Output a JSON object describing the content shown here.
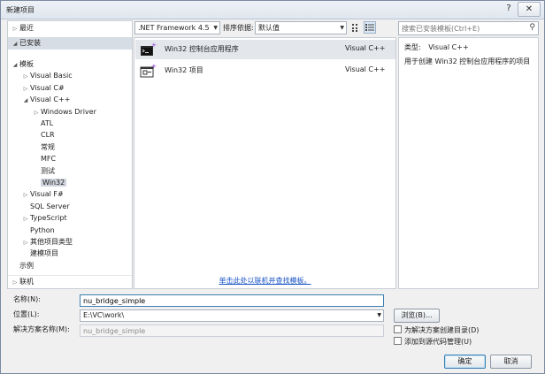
{
  "window": {
    "title": "新建项目",
    "help": "?",
    "close": "✕"
  },
  "left_panel": {
    "recent": "最近",
    "installed": "已安装",
    "tree": [
      {
        "label": "模板",
        "arrow": "◢",
        "indent": 0
      },
      {
        "label": "Visual Basic",
        "arrow": "▷",
        "indent": 1
      },
      {
        "label": "Visual C#",
        "arrow": "▷",
        "indent": 1
      },
      {
        "label": "Visual C++",
        "arrow": "◢",
        "indent": 1
      },
      {
        "label": "Windows Driver",
        "arrow": "▷",
        "indent": 2
      },
      {
        "label": "ATL",
        "arrow": "",
        "indent": 2
      },
      {
        "label": "CLR",
        "arrow": "",
        "indent": 2
      },
      {
        "label": "常规",
        "arrow": "",
        "indent": 2
      },
      {
        "label": "MFC",
        "arrow": "",
        "indent": 2
      },
      {
        "label": "测试",
        "arrow": "",
        "indent": 2
      },
      {
        "label": "Win32",
        "arrow": "",
        "indent": 2,
        "selected": true
      },
      {
        "label": "Visual F#",
        "arrow": "▷",
        "indent": 1
      },
      {
        "label": "SQL Server",
        "arrow": "",
        "indent": 1
      },
      {
        "label": "TypeScript",
        "arrow": "▷",
        "indent": 1
      },
      {
        "label": "Python",
        "arrow": "",
        "indent": 1
      },
      {
        "label": "其他项目类型",
        "arrow": "▷",
        "indent": 1
      },
      {
        "label": "建模项目",
        "arrow": "",
        "indent": 1
      },
      {
        "label": "示例",
        "arrow": "",
        "indent": 0
      }
    ],
    "online": "联机"
  },
  "toolbar": {
    "framework": ".NET Framework 4.5",
    "sort_label": "排序依据:",
    "sort_value": "默认值",
    "view_small_icons": "small-icons-view",
    "view_list": "list-view"
  },
  "search": {
    "placeholder": "搜索已安装模板(Ctrl+E)",
    "icon": "search-icon"
  },
  "templates": [
    {
      "name": "Win32 控制台应用程序",
      "lang": "Visual C++",
      "icon": "console-app-icon",
      "selected": true
    },
    {
      "name": "Win32 项目",
      "lang": "Visual C++",
      "icon": "win32-project-icon",
      "selected": false
    }
  ],
  "online_link": "单击此处以联机并查找模板。",
  "details": {
    "type_label": "类型:",
    "type_value": "Visual C++",
    "description": "用于创建 Win32 控制台应用程序的项目"
  },
  "form": {
    "name_label": "名称(N):",
    "name_value": "nu_bridge_simple",
    "location_label": "位置(L):",
    "location_value": "E:\\VC\\work\\",
    "solution_label": "解决方案名称(M):",
    "solution_value": "nu_bridge_simple",
    "browse": "浏览(B)...",
    "create_dir": "为解决方案创建目录(D)",
    "add_source_control": "添加到源代码管理(U)",
    "ok": "确定",
    "cancel": "取消"
  },
  "colors": {
    "accent": "#3c7fb1",
    "link": "#1a55c7",
    "selection": "#cfd5dc"
  }
}
